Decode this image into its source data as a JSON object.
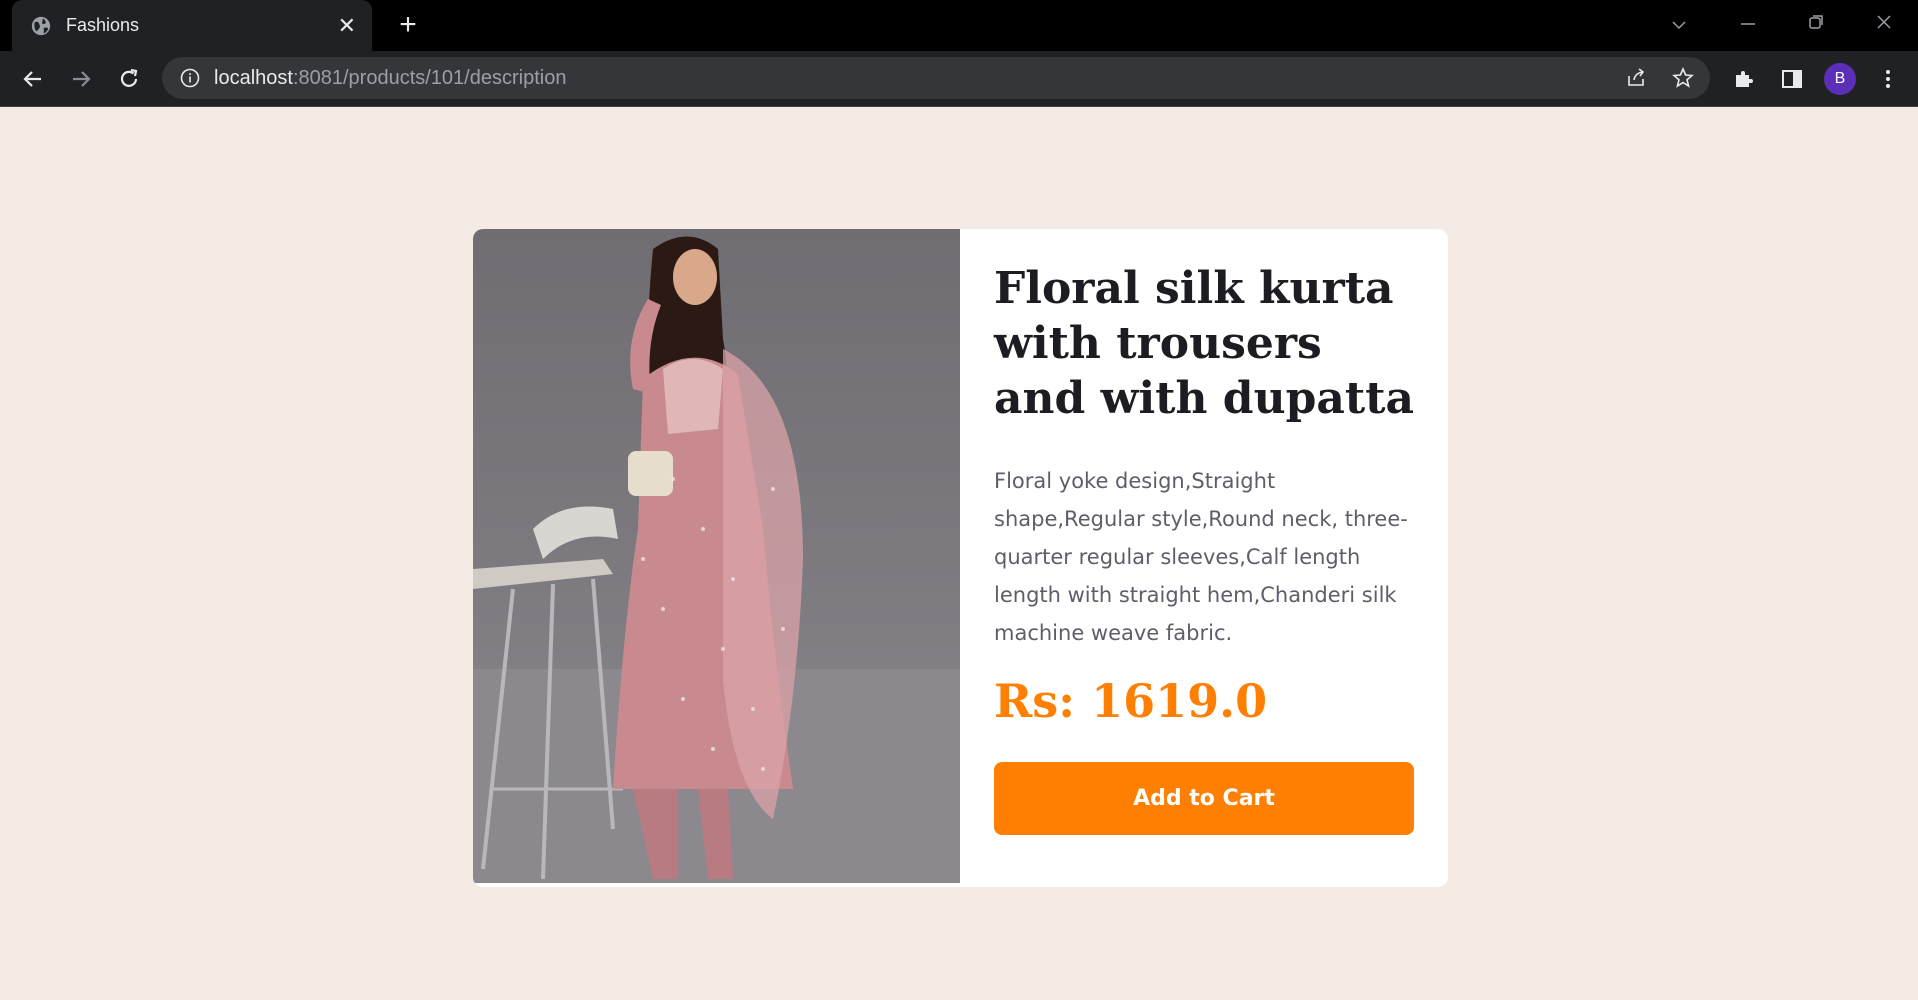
{
  "browser": {
    "tab_title": "Fashions",
    "url_host": "localhost",
    "url_rest": ":8081/products/101/description",
    "profile_initial": "B"
  },
  "product": {
    "title": "Floral silk kurta with trousers and with dupatta",
    "description": "Floral yoke design,Straight shape,Regular style,Round neck, three-quarter regular sleeves,Calf length length with straight hem,Chanderi silk machine weave fabric.",
    "price": "Rs: 1619.0",
    "add_to_cart_label": "Add to Cart",
    "image_name": "woman-in-pink-kurta-photo"
  },
  "colors": {
    "page_bg": "#f3ebe4",
    "accent": "#ff7f02",
    "title_text": "#1c1c22",
    "body_text": "#5e5e6a"
  }
}
